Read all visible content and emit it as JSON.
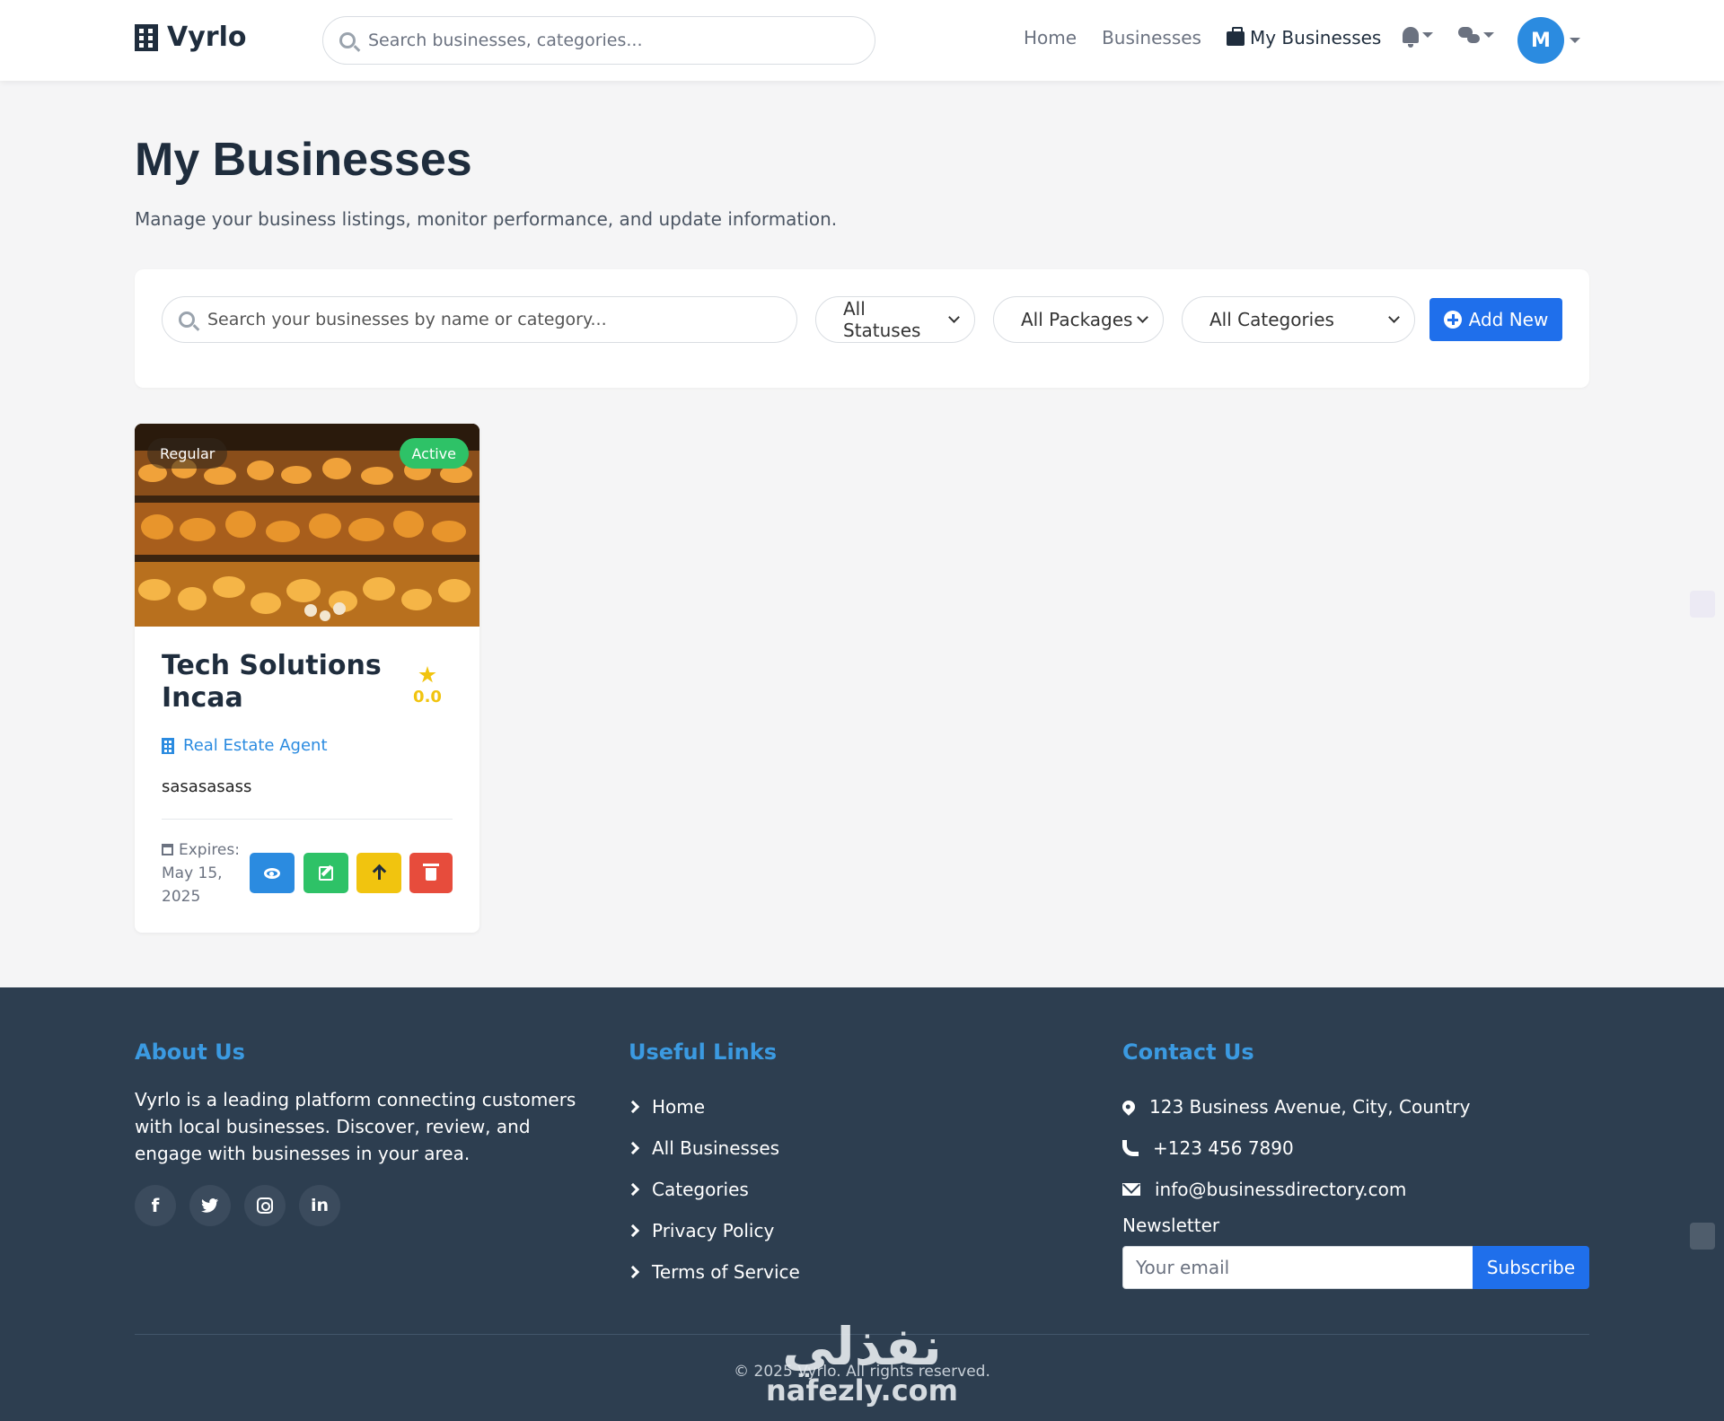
{
  "nav": {
    "brand": "Vyrlo",
    "search_placeholder": "Search businesses, categories...",
    "links": [
      "Home",
      "Businesses"
    ],
    "active_link": "My Businesses",
    "avatar_initial": "M"
  },
  "header": {
    "title": "My Businesses",
    "subtitle": "Manage your business listings, monitor performance, and update information."
  },
  "filters": {
    "search_placeholder": "Search your businesses by name or category...",
    "status": "All Statuses",
    "package": "All Packages",
    "category": "All Categories",
    "add_label": "Add New"
  },
  "business": {
    "package_badge": "Regular",
    "status_badge": "Active",
    "name": "Tech Solutions Incaa",
    "rating": "0.0",
    "category": "Real Estate Agent",
    "description": "sasasasass",
    "expires_label": "Expires:",
    "expires_date": "May 15, 2025"
  },
  "footer": {
    "about_title": "About Us",
    "about_text": "Vyrlo is a leading platform connecting customers with local businesses. Discover, review, and engage with businesses in your area.",
    "links_title": "Useful Links",
    "links": [
      "Home",
      "All Businesses",
      "Categories",
      "Privacy Policy",
      "Terms of Service"
    ],
    "contact_title": "Contact Us",
    "address": "123 Business Avenue, City, Country",
    "phone": "+123 456 7890",
    "email": "info@businessdirectory.com",
    "newsletter_label": "Newsletter",
    "newsletter_placeholder": "Your email",
    "subscribe_label": "Subscribe",
    "copyright": "© 2025 Vyrlo. All rights reserved."
  },
  "watermark": {
    "arabic": "نفذلي",
    "latin": "nafezly.com"
  },
  "colors": {
    "primary": "#1f6feb",
    "accent": "#2b8be0",
    "success": "#2ec267",
    "warning": "#f1c40f",
    "danger": "#e74c3c",
    "footer_bg": "#2d3e50"
  }
}
